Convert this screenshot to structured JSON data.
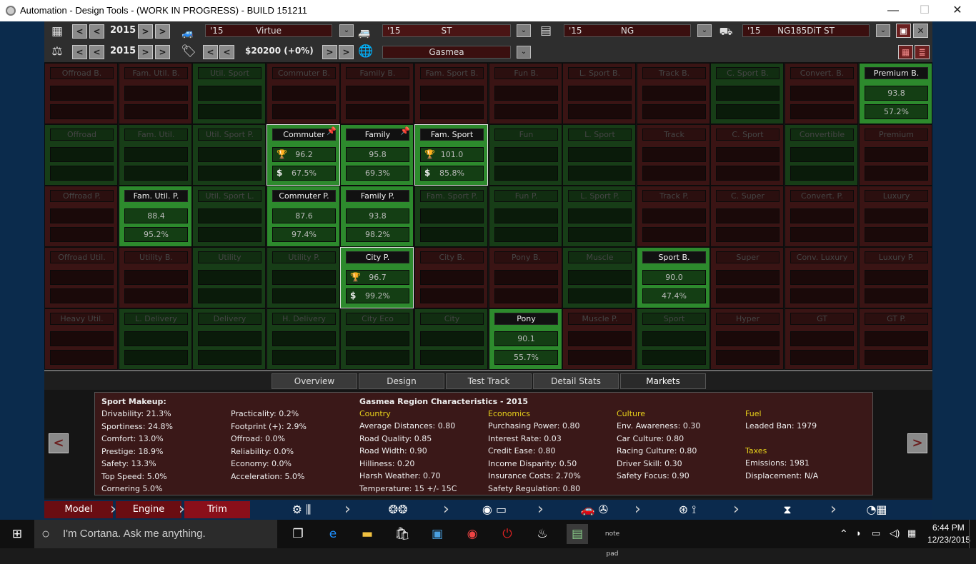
{
  "window": {
    "title": "Automation - Design Tools - (WORK IN PROGRESS) - BUILD 151211",
    "minimize": "—",
    "maximize": "☐",
    "close": "✕"
  },
  "top": {
    "row1": {
      "year": "2015",
      "model": {
        "year": "'15",
        "name": "Virtue"
      },
      "trim": {
        "year": "'15",
        "name": "ST"
      },
      "engine": {
        "year": "'15",
        "name": "NG"
      },
      "variant": {
        "year": "'15",
        "name": "NG185DiT ST"
      }
    },
    "row2": {
      "year": "2015",
      "price": "$20200 (+0%)",
      "region": "Gasmea"
    },
    "btn_prev": "<",
    "btn_prev2": "<",
    "btn_next": ">",
    "btn_next2": ">",
    "dd": "⌄"
  },
  "grid": {
    "cells": [
      {
        "r": 0,
        "c": 0,
        "label": "Offroad B.",
        "tone": "red"
      },
      {
        "r": 0,
        "c": 1,
        "label": "Fam. Util. B.",
        "tone": "red"
      },
      {
        "r": 0,
        "c": 2,
        "label": "Util. Sport",
        "tone": "green"
      },
      {
        "r": 0,
        "c": 3,
        "label": "Commuter B.",
        "tone": "red"
      },
      {
        "r": 0,
        "c": 4,
        "label": "Family B.",
        "tone": "red"
      },
      {
        "r": 0,
        "c": 5,
        "label": "Fam. Sport B.",
        "tone": "red"
      },
      {
        "r": 0,
        "c": 6,
        "label": "Fun B.",
        "tone": "red"
      },
      {
        "r": 0,
        "c": 7,
        "label": "L. Sport B.",
        "tone": "red"
      },
      {
        "r": 0,
        "c": 8,
        "label": "Track B.",
        "tone": "red"
      },
      {
        "r": 0,
        "c": 9,
        "label": "C. Sport B.",
        "tone": "green"
      },
      {
        "r": 0,
        "c": 10,
        "label": "Convert. B.",
        "tone": "red"
      },
      {
        "r": 0,
        "c": 11,
        "label": "Premium B.",
        "tone": "bright",
        "v1": "93.8",
        "v2": "57.2%"
      },
      {
        "r": 1,
        "c": 0,
        "label": "Offroad",
        "tone": "green"
      },
      {
        "r": 1,
        "c": 1,
        "label": "Fam. Util.",
        "tone": "green"
      },
      {
        "r": 1,
        "c": 2,
        "label": "Util. Sport P.",
        "tone": "green"
      },
      {
        "r": 1,
        "c": 3,
        "label": "Commuter",
        "tone": "bright",
        "sel": true,
        "pin": true,
        "v1": "96.2",
        "v2": "67.5%"
      },
      {
        "r": 1,
        "c": 4,
        "label": "Family",
        "tone": "bright",
        "pin": true,
        "v1": "95.8",
        "v2": "69.3%"
      },
      {
        "r": 1,
        "c": 5,
        "label": "Fam. Sport",
        "tone": "bright",
        "sel": true,
        "v1": "101.0",
        "v2": "85.8%"
      },
      {
        "r": 1,
        "c": 6,
        "label": "Fun",
        "tone": "green"
      },
      {
        "r": 1,
        "c": 7,
        "label": "L. Sport",
        "tone": "green"
      },
      {
        "r": 1,
        "c": 8,
        "label": "Track",
        "tone": "red"
      },
      {
        "r": 1,
        "c": 9,
        "label": "C. Sport",
        "tone": "red"
      },
      {
        "r": 1,
        "c": 10,
        "label": "Convertible",
        "tone": "green"
      },
      {
        "r": 1,
        "c": 11,
        "label": "Premium",
        "tone": "red"
      },
      {
        "r": 2,
        "c": 0,
        "label": "Offroad P.",
        "tone": "red"
      },
      {
        "r": 2,
        "c": 1,
        "label": "Fam. Util. P.",
        "tone": "bright",
        "v1": "88.4",
        "v2": "95.2%"
      },
      {
        "r": 2,
        "c": 2,
        "label": "Util. Sport L.",
        "tone": "green"
      },
      {
        "r": 2,
        "c": 3,
        "label": "Commuter P.",
        "tone": "bright",
        "v1": "87.6",
        "v2": "97.4%"
      },
      {
        "r": 2,
        "c": 4,
        "label": "Family P.",
        "tone": "bright",
        "v1": "93.8",
        "v2": "98.2%"
      },
      {
        "r": 2,
        "c": 5,
        "label": "Fam. Sport P.",
        "tone": "green"
      },
      {
        "r": 2,
        "c": 6,
        "label": "Fun P.",
        "tone": "green"
      },
      {
        "r": 2,
        "c": 7,
        "label": "L. Sport P.",
        "tone": "green"
      },
      {
        "r": 2,
        "c": 8,
        "label": "Track P.",
        "tone": "red"
      },
      {
        "r": 2,
        "c": 9,
        "label": "C. Super",
        "tone": "red"
      },
      {
        "r": 2,
        "c": 10,
        "label": "Convert. P.",
        "tone": "red"
      },
      {
        "r": 2,
        "c": 11,
        "label": "Luxury",
        "tone": "red"
      },
      {
        "r": 3,
        "c": 0,
        "label": "Offroad Util.",
        "tone": "red"
      },
      {
        "r": 3,
        "c": 1,
        "label": "Utility B.",
        "tone": "red"
      },
      {
        "r": 3,
        "c": 2,
        "label": "Utility",
        "tone": "green"
      },
      {
        "r": 3,
        "c": 3,
        "label": "Utility P.",
        "tone": "green"
      },
      {
        "r": 3,
        "c": 4,
        "label": "City P.",
        "tone": "bright",
        "sel": true,
        "v1": "96.7",
        "v2": "99.2%"
      },
      {
        "r": 3,
        "c": 5,
        "label": "City B.",
        "tone": "red"
      },
      {
        "r": 3,
        "c": 6,
        "label": "Pony B.",
        "tone": "red"
      },
      {
        "r": 3,
        "c": 7,
        "label": "Muscle",
        "tone": "green"
      },
      {
        "r": 3,
        "c": 8,
        "label": "Sport B.",
        "tone": "bright",
        "v1": "90.0",
        "v2": "47.4%"
      },
      {
        "r": 3,
        "c": 9,
        "label": "Super",
        "tone": "red"
      },
      {
        "r": 3,
        "c": 10,
        "label": "Conv. Luxury",
        "tone": "red"
      },
      {
        "r": 3,
        "c": 11,
        "label": "Luxury P.",
        "tone": "red"
      },
      {
        "r": 4,
        "c": 0,
        "label": "Heavy Util.",
        "tone": "red"
      },
      {
        "r": 4,
        "c": 1,
        "label": "L. Delivery",
        "tone": "green"
      },
      {
        "r": 4,
        "c": 2,
        "label": "Delivery",
        "tone": "green"
      },
      {
        "r": 4,
        "c": 3,
        "label": "H. Delivery",
        "tone": "green"
      },
      {
        "r": 4,
        "c": 4,
        "label": "City Eco",
        "tone": "green"
      },
      {
        "r": 4,
        "c": 5,
        "label": "City",
        "tone": "green"
      },
      {
        "r": 4,
        "c": 6,
        "label": "Pony",
        "tone": "bright",
        "v1": "90.1",
        "v2": "55.7%"
      },
      {
        "r": 4,
        "c": 7,
        "label": "Muscle P.",
        "tone": "red"
      },
      {
        "r": 4,
        "c": 8,
        "label": "Sport",
        "tone": "green"
      },
      {
        "r": 4,
        "c": 9,
        "label": "Hyper",
        "tone": "red"
      },
      {
        "r": 4,
        "c": 10,
        "label": "GT",
        "tone": "red"
      },
      {
        "r": 4,
        "c": 11,
        "label": "GT P.",
        "tone": "red"
      }
    ]
  },
  "tabs": [
    "Overview",
    "Design",
    "Test Track",
    "Detail Stats",
    "Markets"
  ],
  "active_tab": "Markets",
  "info": {
    "makeup_title": "Sport Makeup:",
    "makeup_col1": [
      "Drivability: 21.3%",
      "Sportiness: 24.8%",
      "Comfort: 13.0%",
      "Prestige: 18.9%",
      "Safety: 13.3%",
      "Top Speed: 5.0%",
      "Cornering 5.0%"
    ],
    "makeup_col2": [
      "Practicality: 0.2%",
      "Footprint (+): 2.9%",
      "Offroad: 0.0%",
      "Reliability: 0.0%",
      "Economy: 0.0%",
      "Acceleration: 5.0%"
    ],
    "region_title": "Gasmea Region Characteristics - 2015",
    "country_title": "Country",
    "country": [
      "Average Distances: 0.80",
      "Road Quality: 0.85",
      "Road Width: 0.90",
      "Hilliness: 0.20",
      "Harsh Weather: 0.70",
      "Temperature: 15 +/- 15C"
    ],
    "economics_title": "Economics",
    "economics": [
      "Purchasing Power: 0.80",
      "Interest Rate: 0.03",
      "Credit Ease: 0.80",
      "Income Disparity: 0.50",
      "Insurance Costs: 2.70%",
      "Safety Regulation: 0.80"
    ],
    "culture_title": "Culture",
    "culture": [
      "Env. Awareness: 0.30",
      "Car Culture: 0.80",
      "Racing Culture: 0.80",
      "Driver Skill: 0.30",
      "Safety Focus: 0.90"
    ],
    "fuel_title": "Fuel",
    "fuel": [
      "Leaded Ban: 1979"
    ],
    "taxes_title": "Taxes",
    "taxes": [
      "Emissions: 1981",
      "Displacement: N/A"
    ],
    "prev": "<",
    "next": ">"
  },
  "bottom": {
    "model": "Model",
    "engine": "Engine",
    "trim": "Trim"
  },
  "taskbar": {
    "cortana": "I'm Cortana. Ask me anything.",
    "time": "6:44 PM",
    "date": "12/23/2015"
  },
  "colors": {
    "red": "#3a1414",
    "green": "#173d17",
    "bright": "#2d8a2d"
  }
}
